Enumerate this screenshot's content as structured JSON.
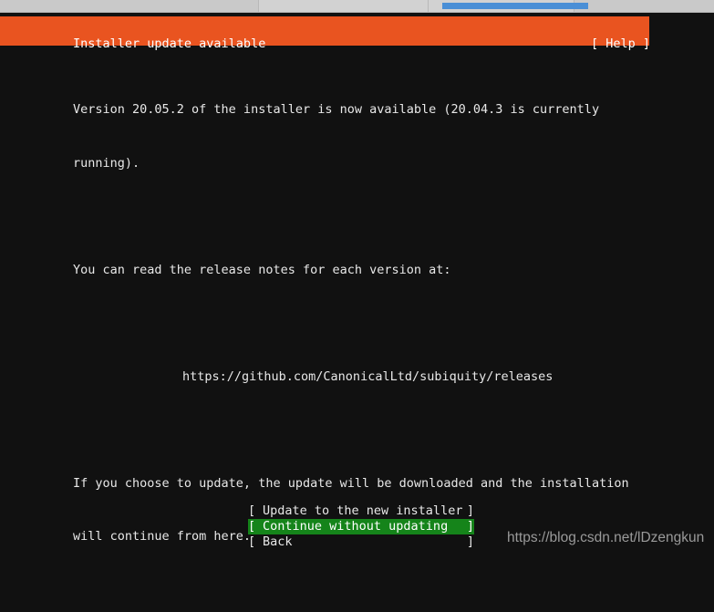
{
  "window_chrome": {
    "tab_segments": [
      "tab-left",
      "tab-active",
      "tab-right"
    ],
    "progress_color": "#4a8fd6",
    "bar_color": "#cccccc"
  },
  "header": {
    "title": "Installer update available",
    "help_label": "[ Help ]",
    "background_color": "#e95420",
    "text_color": "#ffffff"
  },
  "content": {
    "paragraph_1_line_1": "Version 20.05.2 of the installer is now available (20.04.3 is currently",
    "paragraph_1_line_2": "running).",
    "paragraph_2_line_1": "You can read the release notes for each version at:",
    "release_notes_url": "https://github.com/CanonicalLtd/subiquity/releases",
    "paragraph_3_line_1": "If you choose to update, the update will be downloaded and the installation",
    "paragraph_3_line_2": "will continue from here."
  },
  "menu": {
    "selected_index": 1,
    "bracket_open": "[",
    "bracket_close": "]",
    "highlight_color": "#15841a",
    "items": [
      {
        "label": "Update to the new installer",
        "selected": false
      },
      {
        "label": "Continue without updating",
        "selected": true
      },
      {
        "label": "Back",
        "selected": false
      }
    ]
  },
  "watermark": {
    "text": "https://blog.csdn.net/lDzengkun",
    "color": "#9a9a9a"
  }
}
